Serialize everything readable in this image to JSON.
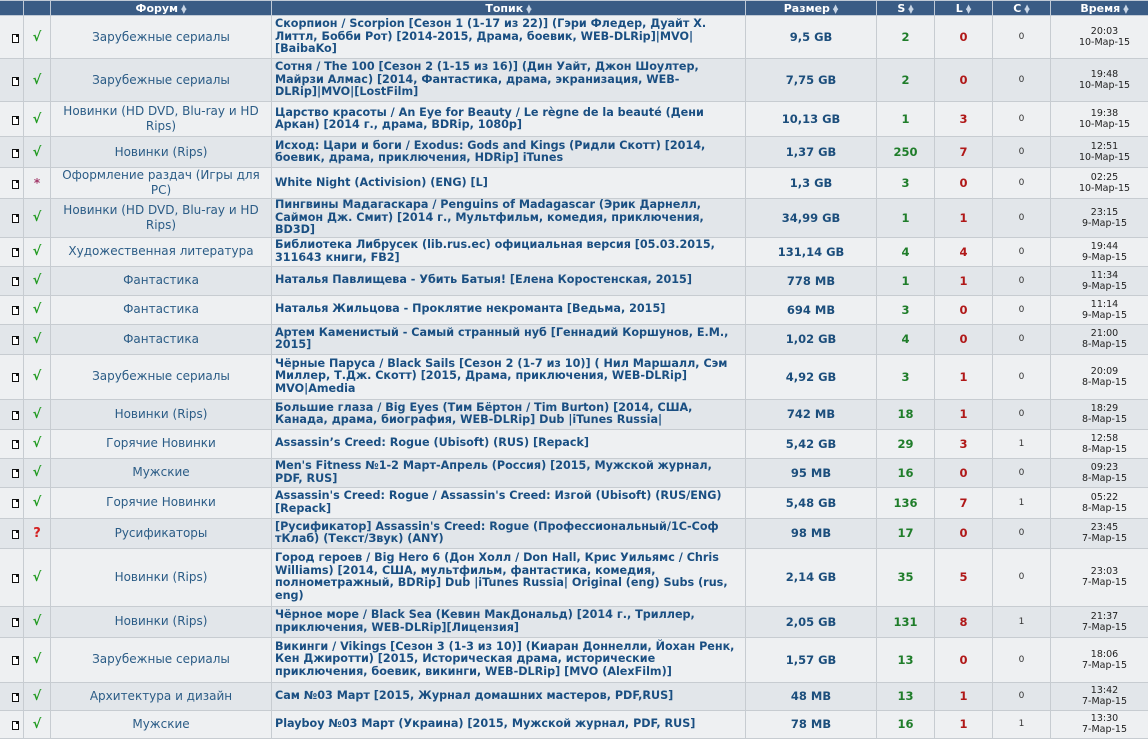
{
  "header": {
    "forum": "Форум",
    "topic": "Топик",
    "size": "Размер",
    "seeds": "S",
    "leech": "L",
    "completed": "C",
    "time": "Время"
  },
  "icons": {
    "file": "file-icon",
    "sort": "sort-arrows-icon"
  },
  "colors": {
    "header_bg": "#3a5c85",
    "seed": "#1f7d2a",
    "leech": "#b01818",
    "link": "#1a4f82",
    "checked": "#1f9a1f"
  },
  "rows": [
    {
      "status": "√",
      "status_type": "ok",
      "forum": "Зарубежные сериалы",
      "topic": "Скорпион / Scorpion [Сезон 1 (1-17 из 22)] (Гэри Флед­ер, Дуайт Х. Литтл, Бобби Рот) [2014-2015, Драма, боевик, WEB-DLRip]|MVO| [BaibaKo]",
      "size": "9,5 GB",
      "seeds": "2",
      "leech": "0",
      "completed": "0",
      "time": "20:03",
      "date": "10-Мар-15",
      "h": 43
    },
    {
      "status": "√",
      "status_type": "ok",
      "forum": "Зарубежные сериалы",
      "topic": "Сотня / The 100 [Сезон 2 (1-15 из 16)] (Дин Уайт, Джон Шоултер, Майрзи Алмас) [2014, Фантастика, драма, экранизация, WEB-DLRip]|MVO|[LostFilm]",
      "size": "7,75 GB",
      "seeds": "2",
      "leech": "0",
      "completed": "0",
      "time": "19:48",
      "date": "10-Мар-15",
      "h": 43
    },
    {
      "status": "√",
      "status_type": "ok",
      "forum": "Новинки (HD DVD, Blu-ray и HD Rips)",
      "topic": "Царство красоты / An Eye for Beauty / Le règne de la beauté (Дени Аркан) [2014 г., драма, BDRip, 1080p]",
      "size": "10,13 GB",
      "seeds": "1",
      "leech": "3",
      "completed": "0",
      "time": "19:38",
      "date": "10-Мар-15",
      "h": 35
    },
    {
      "status": "√",
      "status_type": "ok",
      "forum": "Новинки (Rips)",
      "topic": "Исход: Цари и боги / Exodus: Gods and Kings (Ридли Скотт) [2014, боевик, драма, приключения, HDRip] iTunes",
      "size": "1,37 GB",
      "seeds": "250",
      "leech": "7",
      "completed": "0",
      "time": "12:51",
      "date": "10-Мар-15",
      "h": 31
    },
    {
      "status": "*",
      "status_type": "star",
      "forum": "Оформление раздач (Игры для PC)",
      "topic": "White Night (Activision) (ENG) [L]",
      "size": "1,3 GB",
      "seeds": "3",
      "leech": "0",
      "completed": "0",
      "time": "02:25",
      "date": "10-Мар-15",
      "h": 28
    },
    {
      "status": "√",
      "status_type": "ok",
      "forum": "Новинки (HD DVD, Blu-ray и HD Rips)",
      "topic": "Пингвины Мадагаскара / Penguins of Madagascar (Эрик Дарнелл, Саймон Дж. Смит) [2014 г., Мультфильм, комедия, приключения, BD3D]",
      "size": "34,99 GB",
      "seeds": "1",
      "leech": "1",
      "completed": "0",
      "time": "23:15",
      "date": "9-Мар-15",
      "h": 34
    },
    {
      "status": "√",
      "status_type": "ok",
      "forum": "Художественная литература",
      "topic": "Библиотека Либрусек (lib.rus.ec) официальная версия [05.03.2015, 311643 книги, FB2]",
      "size": "131,14 GB",
      "seeds": "4",
      "leech": "4",
      "completed": "0",
      "time": "19:44",
      "date": "9-Мар-15",
      "h": 29
    },
    {
      "status": "√",
      "status_type": "ok",
      "forum": "Фантастика",
      "topic": "Наталья Павлищева - Убить Батыя! [Елена Коростенская, 2015]",
      "size": "778 MB",
      "seeds": "1",
      "leech": "1",
      "completed": "0",
      "time": "11:34",
      "date": "9-Мар-15",
      "h": 29
    },
    {
      "status": "√",
      "status_type": "ok",
      "forum": "Фантастика",
      "topic": "Наталья Жильцова - Проклятие некроманта [Ведьма, 2015]",
      "size": "694 MB",
      "seeds": "3",
      "leech": "0",
      "completed": "0",
      "time": "11:14",
      "date": "9-Мар-15",
      "h": 29
    },
    {
      "status": "√",
      "status_type": "ok",
      "forum": "Фантастика",
      "topic": "Артем Каменистый - Самый странный нуб [Геннадий Коршунов, Е.М., 2015]",
      "size": "1,02 GB",
      "seeds": "4",
      "leech": "0",
      "completed": "0",
      "time": "21:00",
      "date": "8-Мар-15",
      "h": 30
    },
    {
      "status": "√",
      "status_type": "ok",
      "forum": "Зарубежные сериалы",
      "topic": "Чёрные Паруса / Black Sails [Сезон 2 (1-7 из 10)] ( Нил Маршалл, Сэм Миллер, Т.Дж. Скотт) [2015, Драма, приключения, WEB-DLRip] MVO|Amedia",
      "size": "4,92 GB",
      "seeds": "3",
      "leech": "1",
      "completed": "0",
      "time": "20:09",
      "date": "8-Мар-15",
      "h": 45
    },
    {
      "status": "√",
      "status_type": "ok",
      "forum": "Новинки (Rips)",
      "topic": "Большие глаза / Big Eyes (Тим Бёртон / Tim Burton) [2014, США, Канада, драма, биография, WEB-DLRip] Dub |iTunes Russia|",
      "size": "742 MB",
      "seeds": "18",
      "leech": "1",
      "completed": "0",
      "time": "18:29",
      "date": "8-Мар-15",
      "h": 30
    },
    {
      "status": "√",
      "status_type": "ok",
      "forum": "Горячие Новинки",
      "topic": "Assassin’s Creed: Rogue (Ubisoft) (RUS) [Repack]",
      "size": "5,42 GB",
      "seeds": "29",
      "leech": "3",
      "completed": "1",
      "time": "12:58",
      "date": "8-Мар-15",
      "h": 29
    },
    {
      "status": "√",
      "status_type": "ok",
      "forum": "Мужские",
      "topic": "Men's Fitness №1-2 Март-Апрель (Россия) [2015, Мужской журнал, PDF, RUS]",
      "size": "95 MB",
      "seeds": "16",
      "leech": "0",
      "completed": "0",
      "time": "09:23",
      "date": "8-Мар-15",
      "h": 29
    },
    {
      "status": "√",
      "status_type": "ok",
      "forum": "Горячие Новинки",
      "topic": "Assassin's Creed: Rogue / Assassin's Creed: Изгой (Ubisoft) (RUS/ENG) [Repack]",
      "size": "5,48 GB",
      "seeds": "136",
      "leech": "7",
      "completed": "1",
      "time": "05:22",
      "date": "8-Мар-15",
      "h": 31
    },
    {
      "status": "?",
      "status_type": "q",
      "forum": "Русификаторы",
      "topic": "[Русификатор] Assassin's Creed: Rogue (Профессиональный/1С-Соф тКлаб) (Текст/Звук) (ANY)",
      "size": "98 MB",
      "seeds": "17",
      "leech": "0",
      "completed": "0",
      "time": "23:45",
      "date": "7-Мар-15",
      "h": 30
    },
    {
      "status": "√",
      "status_type": "ok",
      "forum": "Новинки (Rips)",
      "topic": "Город героев / Big Hero 6 (Дон Холл / Don Hall, Крис Уильямс / Chris Williams) [2014, США, мультфильм, фантастика, комедия, полнометражный, BDRip] Dub |iTunes Russia| Original (eng) Subs (rus, eng)",
      "size": "2,14 GB",
      "seeds": "35",
      "leech": "5",
      "completed": "0",
      "time": "23:03",
      "date": "7-Мар-15",
      "h": 58
    },
    {
      "status": "√",
      "status_type": "ok",
      "forum": "Новинки (Rips)",
      "topic": "Чёрное море / Black Sea (Кевин МакДональд) [2014 г., Триллер, приключения, WEB-DLRip][Лицензия]",
      "size": "2,05 GB",
      "seeds": "131",
      "leech": "8",
      "completed": "1",
      "time": "21:37",
      "date": "7-Мар-15",
      "h": 31
    },
    {
      "status": "√",
      "status_type": "ok",
      "forum": "Зарубежные сериалы",
      "topic": "Викинги / Vikings [Сезон 3 (1-3 из 10)] (Киаран Доннелли, Йохан Ренк, Кен Джиротти) [2015, Историческая драма, исторические приключения, боевик, викинги, WEB-DLRip] [MVO (AlexFilm)]",
      "size": "1,57 GB",
      "seeds": "13",
      "leech": "0",
      "completed": "0",
      "time": "18:06",
      "date": "7-Мар-15",
      "h": 45
    },
    {
      "status": "√",
      "status_type": "ok",
      "forum": "Архитектура и дизайн",
      "topic": "Сам №03 Март [2015, Журнал домашних мастеров, PDF,RUS]",
      "size": "48 MB",
      "seeds": "13",
      "leech": "1",
      "completed": "0",
      "time": "13:42",
      "date": "7-Мар-15",
      "h": 28
    },
    {
      "status": "√",
      "status_type": "ok",
      "forum": "Мужские",
      "topic": "Playboy №03 Март (Украина) [2015, Мужской журнал, PDF, RUS]",
      "size": "78 MB",
      "seeds": "16",
      "leech": "1",
      "completed": "1",
      "time": "13:30",
      "date": "7-Мар-15",
      "h": 28
    }
  ]
}
